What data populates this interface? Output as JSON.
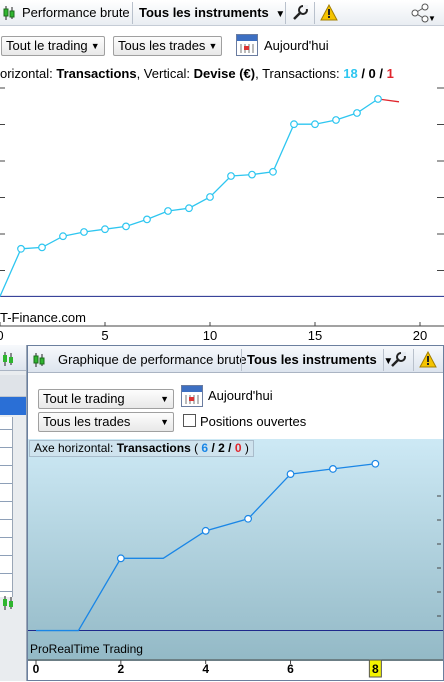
{
  "top_window": {
    "toolbar": {
      "app_tab": "Performance brute",
      "instruments_tab": "Tous les instruments"
    },
    "filters": {
      "trading": "Tout le trading",
      "trades": "Tous les trades",
      "date": "Aujourd'hui"
    },
    "axis_caption": {
      "prefix": "orizontal: ",
      "h_axis": "Transactions",
      "mid": ", Vertical: ",
      "v_axis": "Devise (€)",
      "tx_label": ", Transactions: ",
      "total": "18",
      "sep1": " / ",
      "neutral": "0",
      "sep2": " / ",
      "losing": "1"
    },
    "watermark": "T-Finance.com",
    "colors": {
      "line": "#2ec6f0",
      "baseline": "#1e2a8c",
      "loss": "#e0262d",
      "win_count": "#2ec6f0",
      "loss_count": "#e0262d"
    }
  },
  "bottom_window": {
    "toolbar": {
      "title": "Graphique de performance brute",
      "instruments_tab": "Tous les instruments"
    },
    "filters": {
      "trading": "Tout le trading",
      "trades": "Tous les trades",
      "date": "Aujourd'hui",
      "open_positions_label": "Positions ouvertes",
      "open_positions_checked": false
    },
    "axis_caption": {
      "prefix": "Axe horizontal: ",
      "h_axis": "Transactions",
      "open": "  ( ",
      "total": "6",
      "sep1": " / ",
      "neutral": "2",
      "sep2": " / ",
      "losing": "0",
      "close": " )"
    },
    "watermark": "ProRealTime Trading",
    "colors": {
      "line": "#1a86e6",
      "plot_bg_top": "#c9e7f3",
      "plot_bg_bottom": "#93b9c6",
      "baseline": "#1e2a8c",
      "highlight": "#f3f300"
    }
  },
  "chart_data": [
    {
      "type": "line",
      "x": [
        0,
        1,
        2,
        3,
        4,
        5,
        6,
        7,
        8,
        9,
        10,
        11,
        12,
        13,
        14,
        15,
        16,
        17,
        18,
        19
      ],
      "y": [
        0,
        17,
        17.5,
        21.5,
        23,
        24,
        25,
        27.5,
        30.5,
        31.5,
        35.5,
        43,
        43.5,
        44.5,
        61.5,
        61.5,
        63,
        65.5,
        70.5,
        69.5
      ],
      "loss_segment_from_index": 18,
      "x_ticks": [
        "0",
        "5",
        "10",
        "15",
        "20"
      ],
      "xlim": [
        0,
        21
      ],
      "ylim": [
        -2,
        78
      ],
      "grid": true
    },
    {
      "type": "line",
      "x": [
        0,
        1,
        2,
        3,
        4,
        5,
        6,
        7,
        8
      ],
      "y": [
        0,
        0,
        4.2,
        4.2,
        5.8,
        6.5,
        9.1,
        9.4,
        9.7
      ],
      "x_ticks": [
        "0",
        "2",
        "4",
        "6",
        "8"
      ],
      "highlighted_tick": "8",
      "xlim": [
        0,
        9.5
      ],
      "ylim": [
        -0.2,
        10.5
      ],
      "grid": false
    }
  ]
}
